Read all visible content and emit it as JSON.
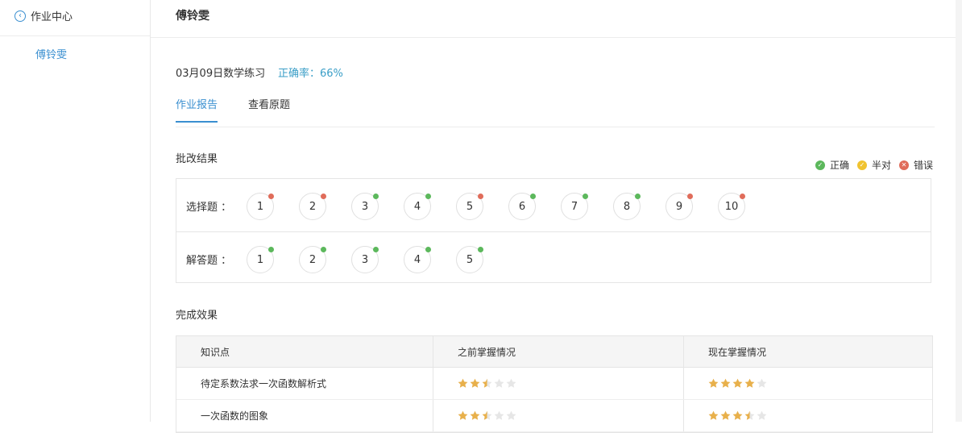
{
  "sidebar": {
    "back_label": "作业中心",
    "student_name": "傅铃雯"
  },
  "header": {
    "title": "傅铃雯"
  },
  "homework": {
    "title": "03月09日数学练习",
    "accuracy": "正确率：66%",
    "accuracy_percent": 66
  },
  "tabs": [
    {
      "label": "作业报告",
      "active": true
    },
    {
      "label": "查看原题",
      "active": false
    }
  ],
  "grading": {
    "section_title": "批改结果",
    "legend": [
      {
        "label": "正确",
        "status": "correct",
        "color": "#5cb85c",
        "icon": "check-icon"
      },
      {
        "label": "半对",
        "status": "half",
        "color": "#f0c330",
        "icon": "check-icon"
      },
      {
        "label": "错误",
        "status": "wrong",
        "color": "#e06c5a",
        "icon": "cross-icon"
      }
    ],
    "rows": [
      {
        "label": "选择题 ：",
        "questions": [
          {
            "number": "1",
            "status": "wrong"
          },
          {
            "number": "2",
            "status": "wrong"
          },
          {
            "number": "3",
            "status": "correct"
          },
          {
            "number": "4",
            "status": "correct"
          },
          {
            "number": "5",
            "status": "wrong"
          },
          {
            "number": "6",
            "status": "correct"
          },
          {
            "number": "7",
            "status": "correct"
          },
          {
            "number": "8",
            "status": "correct"
          },
          {
            "number": "9",
            "status": "wrong"
          },
          {
            "number": "10",
            "status": "wrong"
          }
        ]
      },
      {
        "label": "解答题 ：",
        "questions": [
          {
            "number": "1",
            "status": "correct"
          },
          {
            "number": "2",
            "status": "correct"
          },
          {
            "number": "3",
            "status": "correct"
          },
          {
            "number": "4",
            "status": "correct"
          },
          {
            "number": "5",
            "status": "correct"
          }
        ]
      }
    ]
  },
  "completion": {
    "section_title": "完成效果",
    "columns": [
      "知识点",
      "之前掌握情况",
      "现在掌握情况"
    ],
    "rows": [
      {
        "topic": "待定系数法求一次函数解析式",
        "before_stars": 2.5,
        "now_stars": 4
      },
      {
        "topic": "一次函数的图象",
        "before_stars": 2.5,
        "now_stars": 3.5
      }
    ],
    "max_stars": 5,
    "star_color": "#e8b04b",
    "empty_star_color": "#e6e6e6"
  }
}
